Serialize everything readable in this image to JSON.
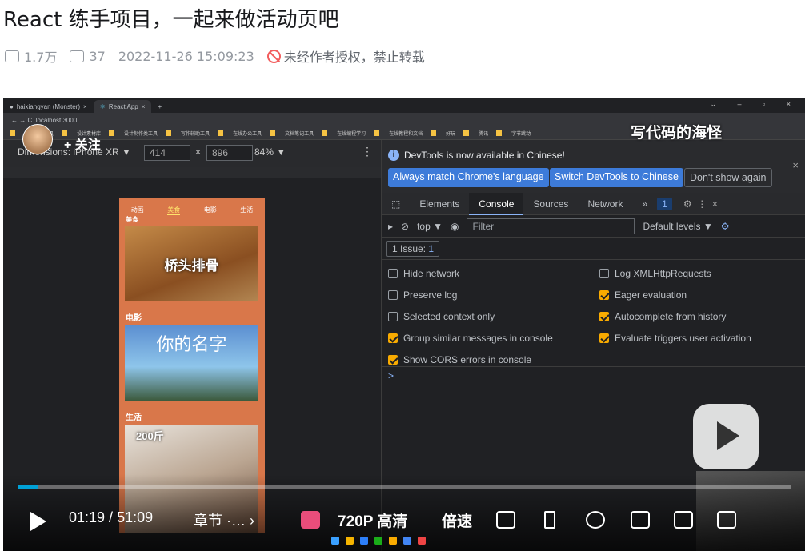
{
  "article": {
    "title": "React 练手项目，一起来做活动页吧",
    "views": "1.7万",
    "comments": "37",
    "datetime": "2022-11-26 15:09:23",
    "notice": "未经作者授权，禁止转载"
  },
  "browser": {
    "tab1": "haixiangyan (Monster)",
    "tab2": "React App",
    "url": "localhost:3000",
    "bookmarks": [
      "开发辅助工具",
      "设计素材库",
      "设计制作类工具",
      "写作辅助工具",
      "在线办公工具",
      "文档笔记工具",
      "在线编程学习",
      "在线教程和文档",
      "好玩",
      "腾讯",
      "字节跳动"
    ]
  },
  "device": {
    "dimensions": "Dimensions: iPhone XR ▼",
    "width": "414",
    "x": "×",
    "height": "896",
    "zoom": "84% ▼"
  },
  "app": {
    "nav": [
      "动画",
      "美食",
      "电影",
      "生活"
    ],
    "sec_food": "美食",
    "food_text": "桥头排骨",
    "sec_movie": "电影",
    "movie_text": "你的名字",
    "sec_life": "生活",
    "life_text": "200斤"
  },
  "devtools": {
    "notice": "DevTools is now available in Chinese!",
    "btn1": "Always match Chrome's language",
    "btn2": "Switch DevTools to Chinese",
    "btn3": "Don't show again",
    "tabs": [
      "Elements",
      "Console",
      "Sources",
      "Network",
      "»"
    ],
    "badge": "1",
    "context": "top ▼",
    "filter": "Filter",
    "levels": "Default levels ▼",
    "issues": "1 Issue:",
    "issues_count": "1",
    "options_left": [
      "Hide network",
      "Preserve log",
      "Selected context only",
      "Group similar messages in console",
      "Show CORS errors in console"
    ],
    "options_right": [
      "Log XMLHttpRequests",
      "Eager evaluation",
      "Autocomplete from history",
      "Evaluate triggers user activation"
    ],
    "checked_left": [
      false,
      false,
      false,
      true,
      true
    ],
    "checked_right": [
      false,
      true,
      true,
      true
    ],
    "prompt": ">"
  },
  "overlay": {
    "up_name": "写代码的海怪",
    "follow": "+ 关注"
  },
  "player": {
    "time": "01:19",
    "duration": "51:09",
    "chapter": "章节 ·… ›",
    "quality": "720P 高清",
    "speed": "倍速",
    "progress": 0.026
  }
}
